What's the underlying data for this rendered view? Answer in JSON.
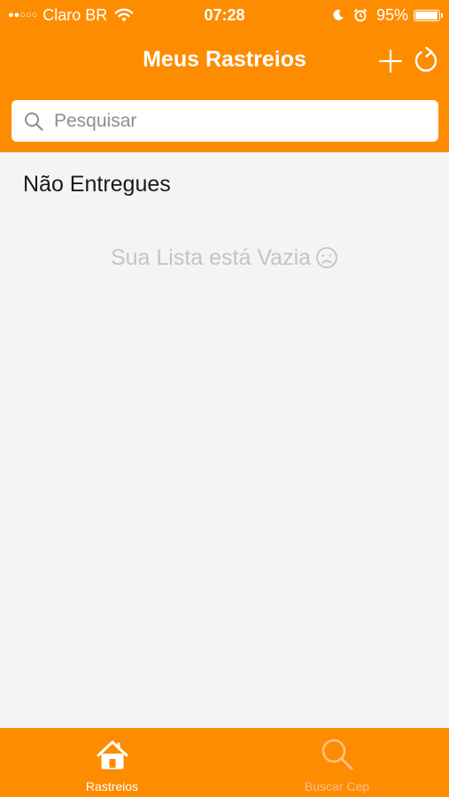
{
  "colors": {
    "brand_orange": "#fd8c00",
    "background": "#f4f4f4",
    "empty_text": "#c4c4c4",
    "inactive_tab": "#fcc189"
  },
  "status_bar": {
    "signal_dots": "●●○○○",
    "carrier": "Claro BR",
    "time": "07:28",
    "battery_percent": "95%",
    "battery_level": 0.95,
    "icons": [
      "wifi-icon",
      "moon-icon",
      "alarm-icon",
      "battery-icon"
    ]
  },
  "nav": {
    "title": "Meus Rastreios",
    "add_icon": "plus-icon",
    "refresh_icon": "refresh-icon"
  },
  "search": {
    "placeholder": "Pesquisar",
    "value": "",
    "icon": "search-icon"
  },
  "list": {
    "section_title": "Não Entregues",
    "empty_message": "Sua Lista está Vazia",
    "empty_icon": "sad-face-icon"
  },
  "tab_bar": {
    "tabs": [
      {
        "label": "Rastreios",
        "icon": "home-icon",
        "active": true
      },
      {
        "label": "Buscar Cep",
        "icon": "search-icon",
        "active": false
      }
    ]
  }
}
